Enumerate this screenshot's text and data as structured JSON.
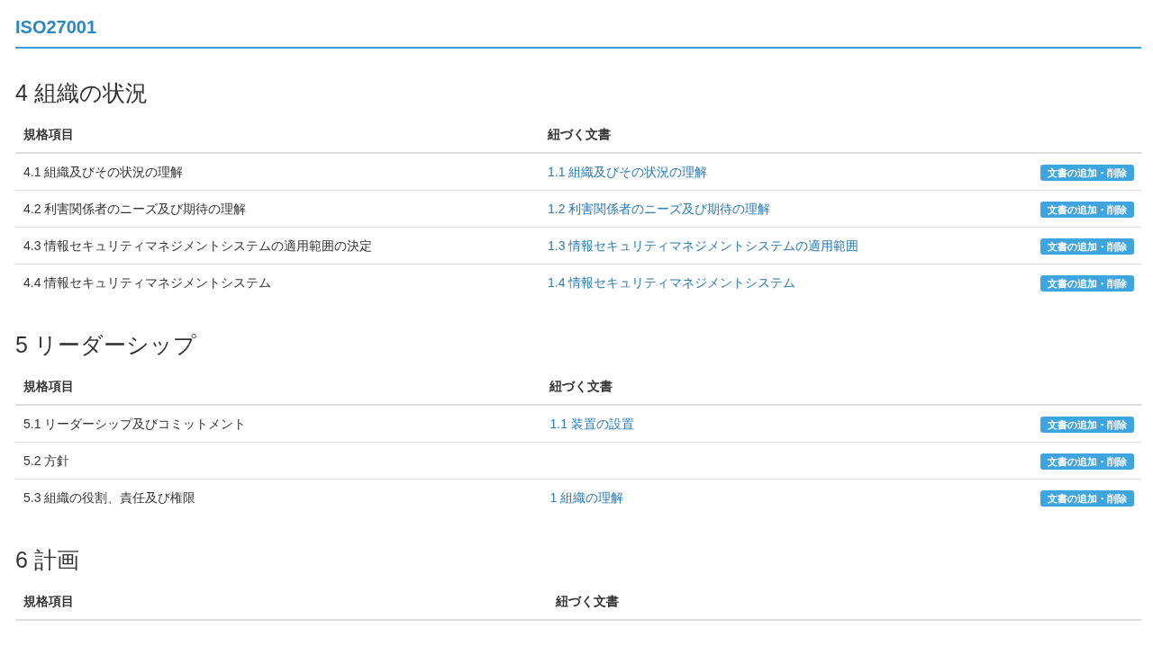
{
  "title": "ISO27001",
  "sections": [
    {
      "heading": "4 組織の状況",
      "columns": [
        "規格項目",
        "紐づく文書"
      ],
      "rows": [
        {
          "item": "4.1 組織及びその状況の理解",
          "document": "1.1 組織及びその状況の理解",
          "button": "文書の追加・削除"
        },
        {
          "item": "4.2 利害関係者のニーズ及び期待の理解",
          "document": "1.2 利害関係者のニーズ及び期待の理解",
          "button": "文書の追加・削除"
        },
        {
          "item": "4.3 情報セキュリティマネジメントシステムの適用範囲の決定",
          "document": "1.3 情報セキュリティマネジメントシステムの適用範囲",
          "button": "文書の追加・削除"
        },
        {
          "item": "4.4 情報セキュリティマネジメントシステム",
          "document": "1.4 情報セキュリティマネジメントシステム",
          "button": "文書の追加・削除"
        }
      ]
    },
    {
      "heading": "5 リーダーシップ",
      "columns": [
        "規格項目",
        "紐づく文書"
      ],
      "rows": [
        {
          "item": "5.1 リーダーシップ及びコミットメント",
          "document": "1.1 装置の設置",
          "button": "文書の追加・削除"
        },
        {
          "item": "5.2 方針",
          "button": "文書の追加・削除"
        },
        {
          "item": "5.3 組織の役割、責任及び権限",
          "document": "1 組織の理解",
          "button": "文書の追加・削除"
        }
      ]
    },
    {
      "heading": "6 計画",
      "columns": [
        "規格項目",
        "紐づく文書"
      ]
    }
  ]
}
